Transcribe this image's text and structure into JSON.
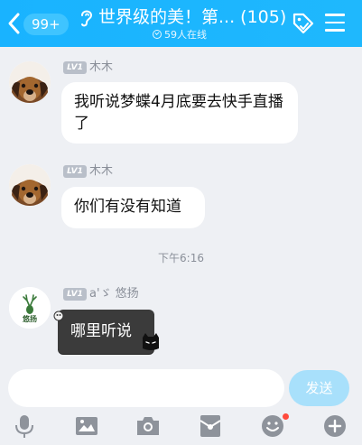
{
  "colors": {
    "header": "#19b3ff",
    "bubble": "#ffffff",
    "send_disabled": "#a8e0fb",
    "icon_gray": "#8e939b",
    "notify": "#ff4a3c"
  },
  "header": {
    "back_icon": "chevron-left-icon",
    "unread_badge": "99+",
    "title": "世界级的美！第... (105)",
    "online": "59人在线"
  },
  "messages": [
    {
      "level": "LV1",
      "nickname": "木木",
      "text": "我听说梦蝶4月底要去快手直播了",
      "avatar": "dog-avatar"
    },
    {
      "level": "LV1",
      "nickname": "木木",
      "text": "你们有没有知道",
      "avatar": "dog-avatar"
    },
    {
      "level": "LV1",
      "nickname": "a'ゞ 悠扬",
      "text": "哪里听说",
      "avatar": "deer-logo-avatar",
      "avatar_text": "悠扬"
    }
  ],
  "timestamp": "下午6:16",
  "input": {
    "placeholder": "",
    "send_label": "发送"
  },
  "toolbar": [
    "microphone-icon",
    "image-icon",
    "camera-icon",
    "red-packet-icon",
    "emoji-icon",
    "plus-icon"
  ]
}
